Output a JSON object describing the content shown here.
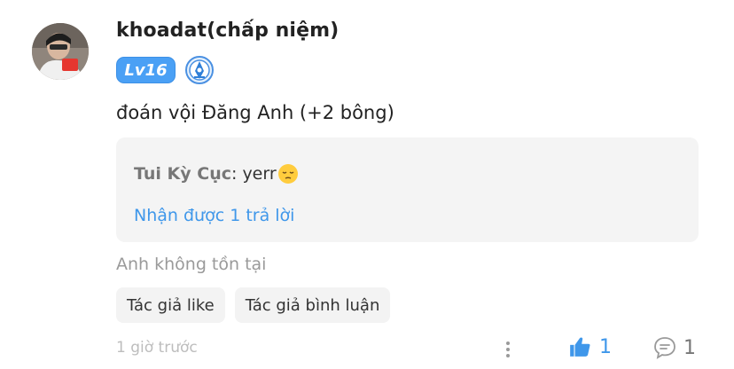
{
  "comment": {
    "username": "khoadat(chấp niệm)",
    "level_badge": "Lv16",
    "text": "đoán vội Đăng Anh (+2 bông)"
  },
  "reply": {
    "author": "Tui Kỳ Cục",
    "separator": ": ",
    "text": "yerr",
    "emoji": "pensive-face-emoji",
    "count_text": "Nhận được 1 trả lời"
  },
  "tag_line": "Anh không tồn tại",
  "chips": [
    {
      "label": "Tác giả like"
    },
    {
      "label": "Tác giả bình luận"
    }
  ],
  "footer": {
    "timestamp": "1 giờ trước",
    "likes": "1",
    "comments": "1"
  },
  "colors": {
    "accent": "#3f97ea",
    "level_badge": "#4aa0f5",
    "reply_bg": "#f4f4f4",
    "chip_bg": "#f3f3f3"
  },
  "icons": [
    "avatar",
    "level-badge",
    "medal-icon",
    "pensive-face-emoji",
    "more-vertical-icon",
    "thumbs-up-icon",
    "comment-icon"
  ]
}
